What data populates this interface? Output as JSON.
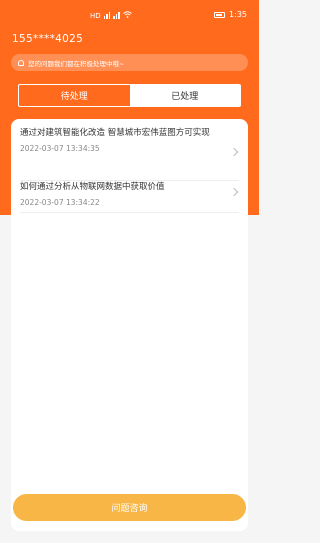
{
  "status_bar": {
    "left_label": "HD",
    "time": "1:35"
  },
  "account": {
    "phone": "155****4025"
  },
  "notice": {
    "text": "您的问题我们都在积极处理中哦~"
  },
  "tabs": [
    {
      "label": "待处理",
      "selected": false
    },
    {
      "label": "已处理",
      "selected": true
    }
  ],
  "items": [
    {
      "title": "通过对建筑智能化改造 智慧城市宏伟蓝图方可实现",
      "date": "2022-03-07 13:34:35"
    },
    {
      "title": "如何通过分析从物联网数据中获取价值",
      "date": "2022-03-07 13:34:22"
    }
  ],
  "actions": {
    "consult_label": "问题咨询"
  },
  "colors": {
    "brand": "#ff6a1c",
    "button": "#f7b645"
  }
}
